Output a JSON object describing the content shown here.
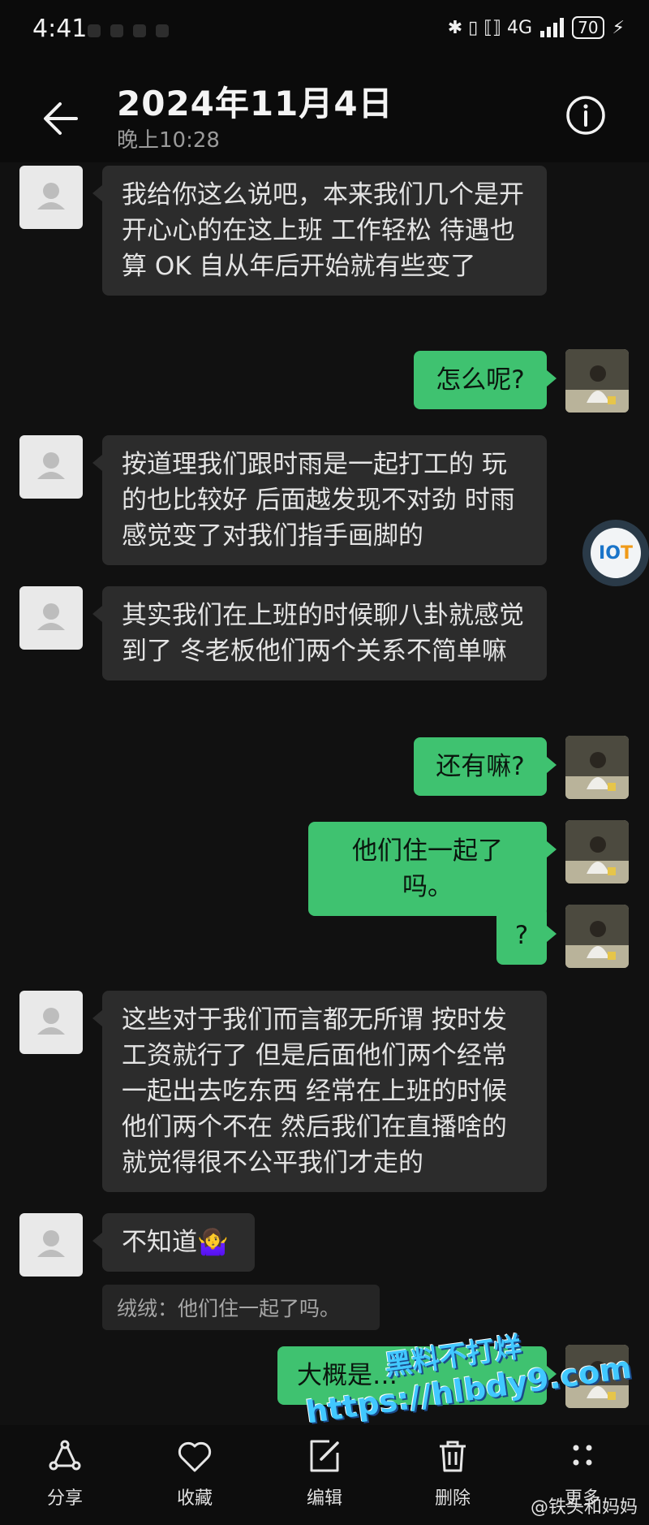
{
  "status_bar": {
    "time": "4:41",
    "indicators": "✱ ▯ ⟦⟧ 4G",
    "battery": "70"
  },
  "header": {
    "title": "2024年11月4日",
    "subtitle": "晚上10:28"
  },
  "messages": [
    {
      "side": "left",
      "text": "我给你这么说吧，本来我们几个是开开心心的在这上班 工作轻松 待遇也算 OK 自从年后开始就有些变了"
    },
    {
      "side": "right",
      "text": "怎么呢?"
    },
    {
      "side": "left",
      "text": "按道理我们跟时雨是一起打工的 玩的也比较好 后面越发现不对劲 时雨感觉变了对我们指手画脚的"
    },
    {
      "side": "left",
      "text": "其实我们在上班的时候聊八卦就感觉到了 冬老板他们两个关系不简单嘛"
    },
    {
      "side": "right",
      "text": "还有嘛?"
    },
    {
      "side": "right",
      "text": "他们住一起了吗。"
    },
    {
      "side": "right",
      "text": "?"
    },
    {
      "side": "left",
      "text": "这些对于我们而言都无所谓 按时发工资就行了 但是后面他们两个经常一起出去吃东西 经常在上班的时候他们两个不在 然后我们在直播啥的 就觉得很不公平我们才走的"
    },
    {
      "side": "left",
      "text": "不知道🤷‍♀️",
      "quote": "绒绒：他们住一起了吗。"
    },
    {
      "side": "right",
      "text": "大概是…"
    }
  ],
  "float_badge": {
    "text_a": "IO",
    "text_b": "T"
  },
  "watermark": {
    "line1": "黑料不打烊",
    "line2": "https://hlbdy9.com"
  },
  "toolbar": {
    "share": "分享",
    "favorite": "收藏",
    "edit": "编辑",
    "delete": "删除",
    "more": "更多"
  },
  "credit": "@铁头和妈妈",
  "colors": {
    "bubble_right": "#3fc270",
    "bubble_left": "#2c2c2c",
    "background": "#111111"
  }
}
